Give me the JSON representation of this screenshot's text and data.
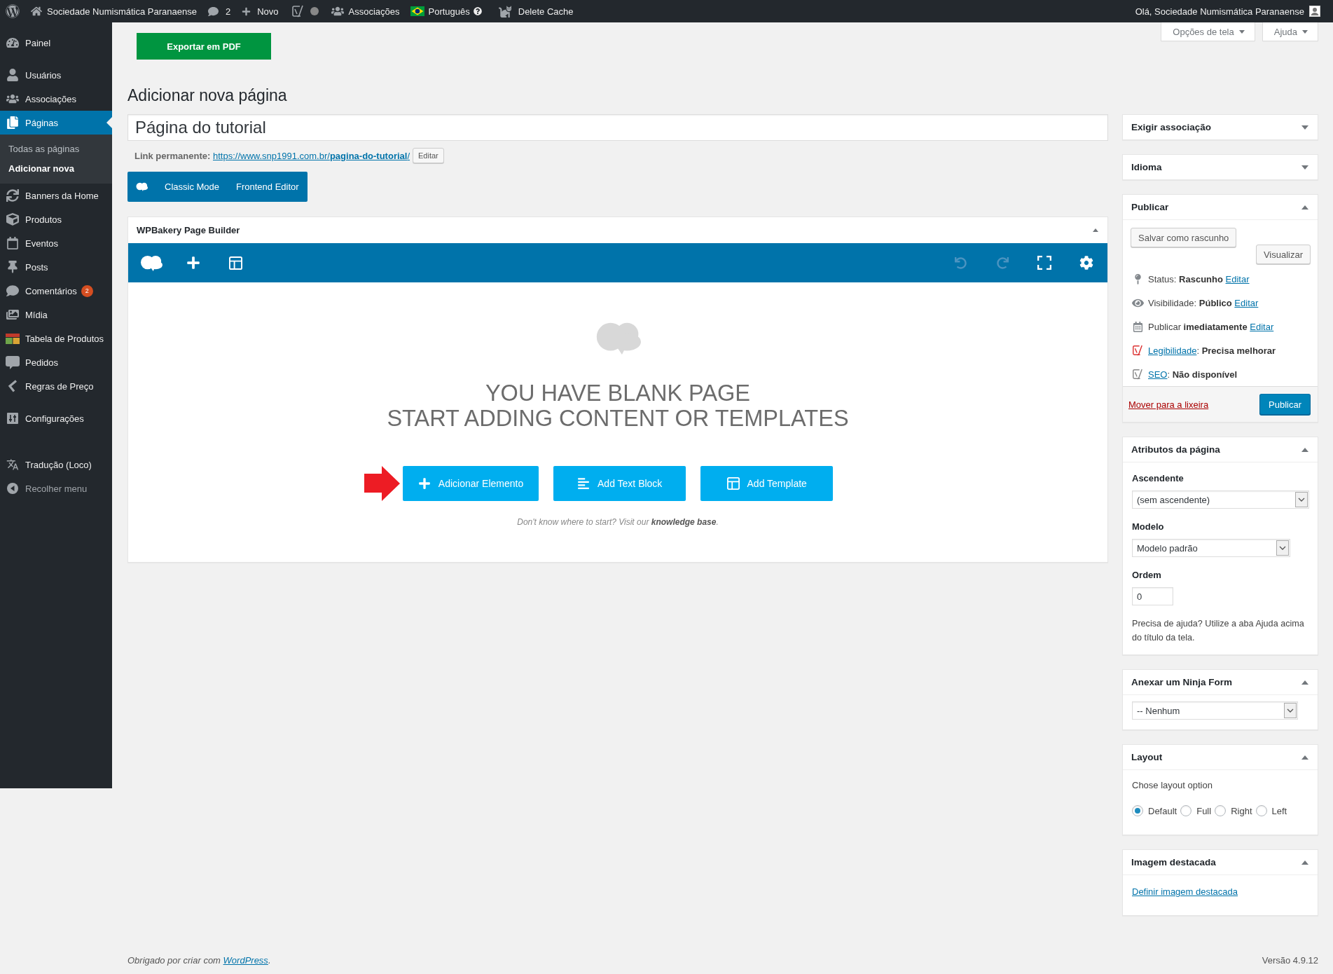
{
  "admin_bar": {
    "site": "Sociedade Numismática Paranaense",
    "comments": "2",
    "new": "Novo",
    "associations": "Associações",
    "language": "Português",
    "cache": "Delete Cache",
    "greeting": "Olá, Sociedade Numismática Paranaense"
  },
  "sidebar": {
    "groups": [
      {
        "items": [
          {
            "label": "Painel",
            "selected": false
          }
        ]
      },
      {
        "items": [
          {
            "label": "Usuários",
            "selected": false
          },
          {
            "label": "Associações",
            "selected": false
          },
          {
            "label": "Páginas",
            "selected": true,
            "children": [
              {
                "label": "Todas as páginas",
                "selected": false
              },
              {
                "label": "Adicionar nova",
                "selected": true
              }
            ]
          },
          {
            "label": "Banners da Home",
            "selected": false
          },
          {
            "label": "Produtos",
            "selected": false
          },
          {
            "label": "Eventos",
            "selected": false
          },
          {
            "label": "Posts",
            "selected": false
          },
          {
            "label": "Comentários",
            "selected": false,
            "badge": "2"
          },
          {
            "label": "Mídia",
            "selected": false
          },
          {
            "label": "Tabela de Produtos",
            "selected": false
          },
          {
            "label": "Pedidos",
            "selected": false
          },
          {
            "label": "Regras de Preço",
            "selected": false
          }
        ]
      },
      {
        "items": [
          {
            "label": "Configurações",
            "selected": false
          }
        ]
      }
    ],
    "footer_items": [
      {
        "label": "Tradução (Loco)",
        "selected": false
      }
    ],
    "collapse": "Recolher menu"
  },
  "screen_tabs": [
    "Opções de tela",
    "Ajuda"
  ],
  "export_button": "Exportar em PDF",
  "heading": "Adicionar nova página",
  "title_field": {
    "value": "Página do tutorial"
  },
  "permalink": {
    "label": "Link permanente:",
    "url": "https://www.snp1991.com.br/**pagina-do-tutorial**/",
    "edit": "Editar"
  },
  "editor_modes": [
    "Classic Mode",
    "Frontend Editor"
  ],
  "page_builder": {
    "title": "WPBakery Page Builder",
    "expanded": true,
    "toolbar": {
      "undo_disabled": true,
      "redo_disabled": true
    },
    "headline": [
      "YOU HAVE BLANK PAGE",
      "START ADDING CONTENT OR TEMPLATES"
    ],
    "actions": [
      {
        "kind": "element",
        "label": "Adicionar Elemento",
        "marked_with_arrow": true
      },
      {
        "kind": "text_block",
        "label": "Add Text Block",
        "marked_with_arrow": false
      },
      {
        "kind": "template",
        "label": "Add Template",
        "marked_with_arrow": false
      }
    ],
    "hint": "Don't know where to start? Visit our **knowledge base**."
  },
  "right_column": {
    "boxes": [
      {
        "title": "Exigir associação",
        "expanded": false
      },
      {
        "title": "Idioma",
        "expanded": false
      },
      {
        "kind": "publish",
        "title": "Publicar",
        "expanded": true,
        "save_draft": "Salvar como rascunho",
        "preview": "Visualizar",
        "rows": [
          {
            "kind": "status",
            "text": "Status: **Rascunho**",
            "link": "Editar"
          },
          {
            "kind": "visibility",
            "text": "Visibilidade: **Público**",
            "link": "Editar"
          },
          {
            "kind": "schedule",
            "text": "Publicar **imediatamente**",
            "link": "Editar"
          },
          {
            "kind": "readability",
            "link": "Legibilidade",
            "text": ": **Precisa melhorar**"
          },
          {
            "kind": "seo",
            "link": "SEO",
            "text": ": **Não disponível**"
          }
        ],
        "trash": "Mover para a lixeira",
        "publish": "Publicar"
      },
      {
        "kind": "attributes",
        "title": "Atributos da página",
        "expanded": true,
        "fields": [
          {
            "kind": "parent_select",
            "label": "Ascendente",
            "value": "(sem ascendente)"
          },
          {
            "kind": "template_select",
            "label": "Modelo",
            "value": "Modelo padrão"
          },
          {
            "kind": "number",
            "label": "Ordem",
            "value": "0"
          }
        ],
        "help": "Precisa de ajuda? Utilize a aba Ajuda acima do título da tela."
      },
      {
        "kind": "ninja_form",
        "title": "Anexar um Ninja Form",
        "expanded": true,
        "value": "-- Nenhum"
      },
      {
        "kind": "layout",
        "title": "Layout",
        "expanded": true,
        "prompt": "Chose layout option",
        "options": [
          {
            "label": "Default",
            "selected": true
          },
          {
            "label": "Full",
            "selected": false
          },
          {
            "label": "Right",
            "selected": false
          },
          {
            "label": "Left",
            "selected": false
          }
        ]
      },
      {
        "kind": "featured_image",
        "title": "Imagem destacada",
        "expanded": true,
        "link": "Definir imagem destacada"
      }
    ]
  },
  "footer": {
    "text": "Obrigado por criar com",
    "link": "WordPress",
    "after": ".",
    "version": "Versão 4.9.12"
  }
}
